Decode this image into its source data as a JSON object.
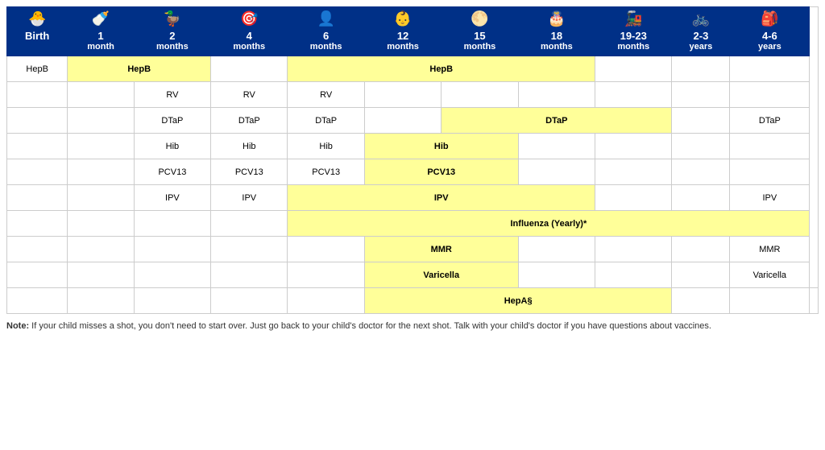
{
  "header": {
    "columns": [
      {
        "icon": "🐣",
        "age": "Birth",
        "sub": ""
      },
      {
        "icon": "🍼",
        "age": "1",
        "sub": "month"
      },
      {
        "icon": "🦆",
        "age": "2",
        "sub": "months"
      },
      {
        "icon": "🎯",
        "age": "4",
        "sub": "months"
      },
      {
        "icon": "👤",
        "age": "6",
        "sub": "months"
      },
      {
        "icon": "👶",
        "age": "12",
        "sub": "months"
      },
      {
        "icon": "🌕",
        "age": "15",
        "sub": "months"
      },
      {
        "icon": "🎂",
        "age": "18",
        "sub": "months"
      },
      {
        "icon": "🚂",
        "age": "19-23",
        "sub": "months"
      },
      {
        "icon": "🚲",
        "age": "2-3",
        "sub": "years"
      },
      {
        "icon": "🎒",
        "age": "4-6",
        "sub": "years"
      }
    ]
  },
  "rows": [
    {
      "label": "HepB"
    },
    {
      "label": ""
    },
    {
      "label": ""
    },
    {
      "label": ""
    },
    {
      "label": ""
    },
    {
      "label": ""
    },
    {
      "label": ""
    },
    {
      "label": ""
    },
    {
      "label": ""
    },
    {
      "label": ""
    },
    {
      "label": ""
    }
  ],
  "note": {
    "bold": "Note:",
    "text": " If your child misses a shot, you don't need to start over. Just go back to your child's doctor for the next shot. Talk with your child's doctor if you have questions about vaccines."
  }
}
